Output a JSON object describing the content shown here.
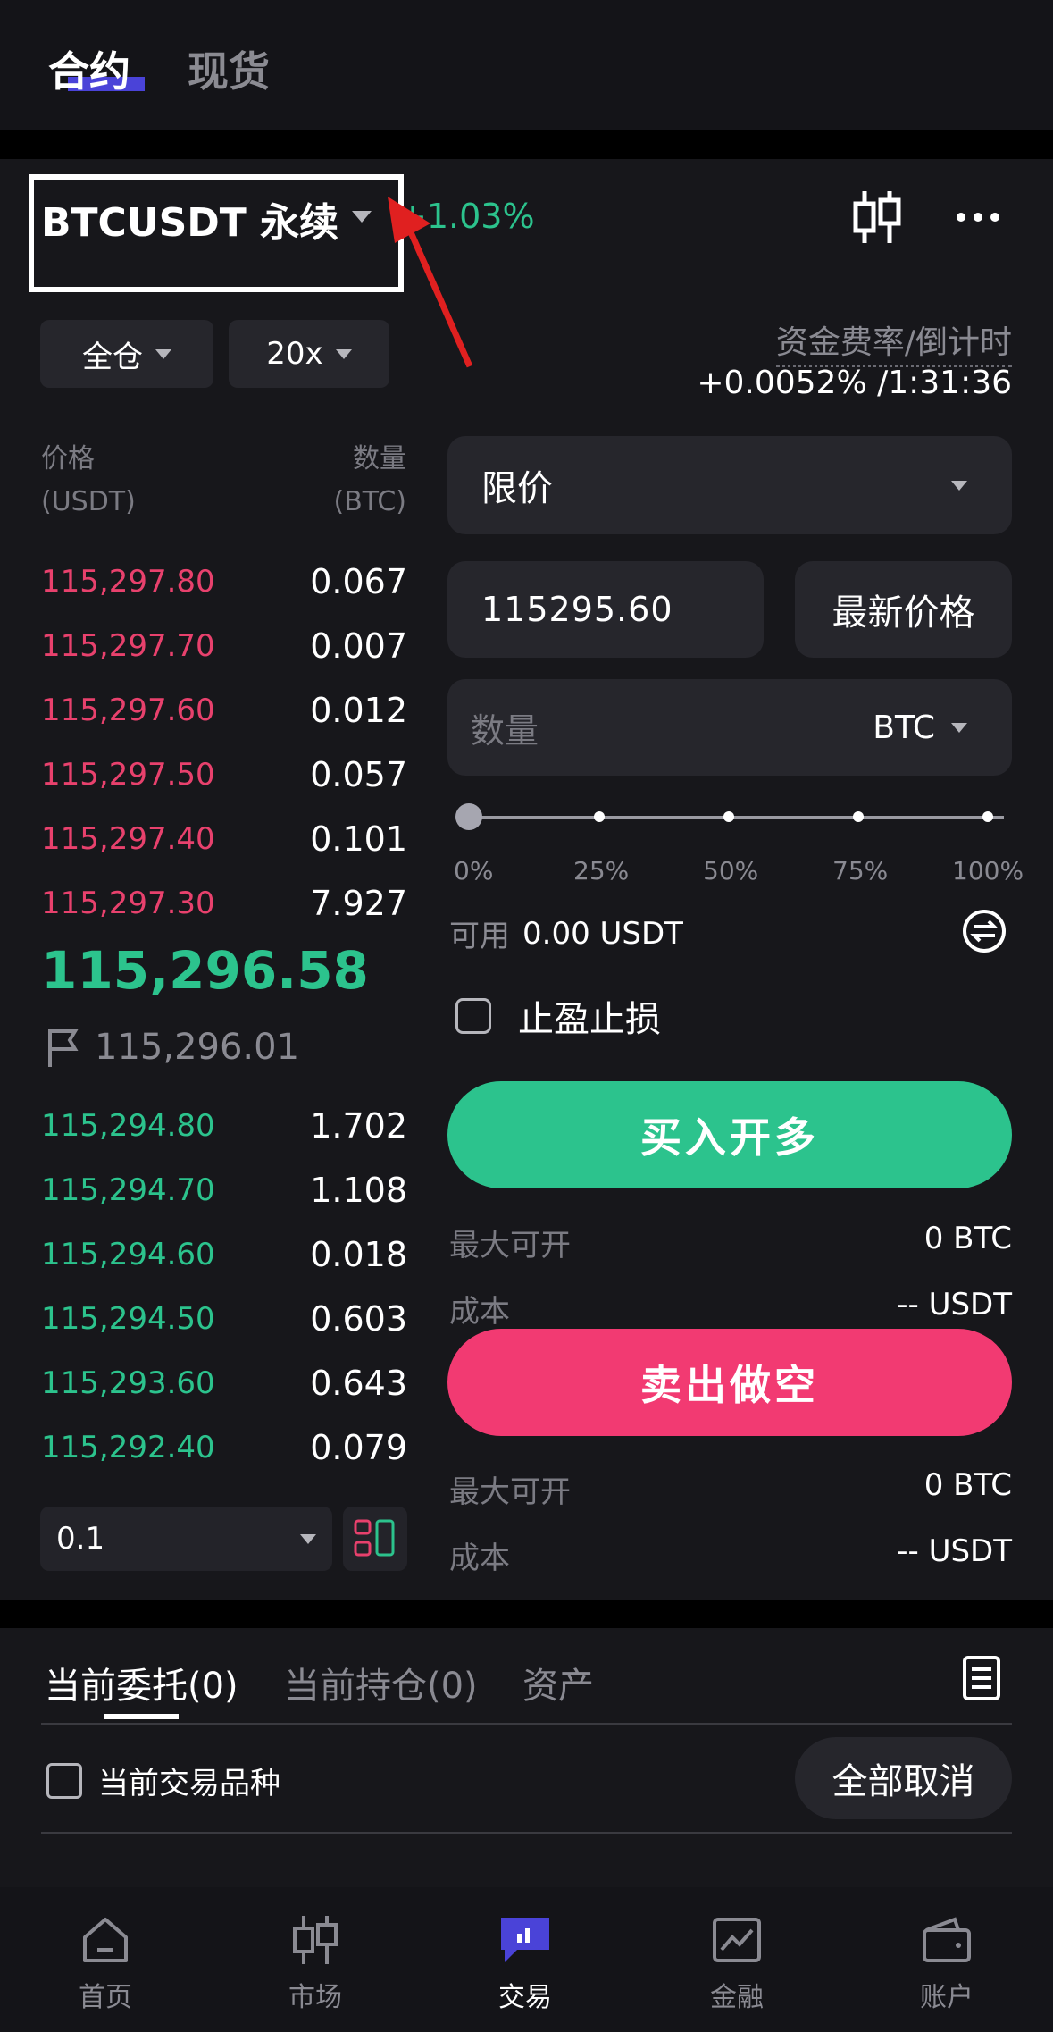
{
  "header": {
    "tabs": [
      {
        "label": "合约"
      },
      {
        "label": "现货"
      }
    ]
  },
  "symbol": {
    "name": "BTCUSDT 永续",
    "change": "+1.03%"
  },
  "margin": {
    "mode": "全仓",
    "leverage": "20x"
  },
  "funding": {
    "label": "资金费率/倒计时",
    "value": "+0.0052% /1:31:36"
  },
  "orderbook": {
    "price_header": "价格",
    "price_unit": "(USDT)",
    "qty_header": "数量",
    "qty_unit": "(BTC)",
    "asks": [
      {
        "price": "115,297.80",
        "qty": "0.067"
      },
      {
        "price": "115,297.70",
        "qty": "0.007"
      },
      {
        "price": "115,297.60",
        "qty": "0.012"
      },
      {
        "price": "115,297.50",
        "qty": "0.057"
      },
      {
        "price": "115,297.40",
        "qty": "0.101"
      },
      {
        "price": "115,297.30",
        "qty": "7.927"
      }
    ],
    "last_price": "115,296.58",
    "mark_price": "115,296.01",
    "bids": [
      {
        "price": "115,294.80",
        "qty": "1.702"
      },
      {
        "price": "115,294.70",
        "qty": "1.108"
      },
      {
        "price": "115,294.60",
        "qty": "0.018"
      },
      {
        "price": "115,294.50",
        "qty": "0.603"
      },
      {
        "price": "115,293.60",
        "qty": "0.643"
      },
      {
        "price": "115,292.40",
        "qty": "0.079"
      }
    ],
    "step": "0.1"
  },
  "order_form": {
    "type": "限价",
    "price_value": "115295.60",
    "latest_price_label": "最新价格",
    "qty_placeholder": "数量",
    "qty_unit": "BTC",
    "slider_marks": [
      "0%",
      "25%",
      "50%",
      "75%",
      "100%"
    ],
    "slider_level": 0,
    "available_label": "可用",
    "available_value": "0.00 USDT",
    "tpsl_label": "止盈止损",
    "buy_label": "买入开多",
    "sell_label": "卖出做空",
    "buy_info": {
      "max_label": "最大可开",
      "max_value": "0 BTC",
      "cost_label": "成本",
      "cost_value": "-- USDT"
    },
    "sell_info": {
      "max_label": "最大可开",
      "max_value": "0 BTC",
      "cost_label": "成本",
      "cost_value": "-- USDT"
    }
  },
  "orders": {
    "tabs": [
      {
        "label": "当前委托(0)"
      },
      {
        "label": "当前持仓(0)"
      },
      {
        "label": "资产"
      }
    ],
    "filter_label": "当前交易品种",
    "cancel_all": "全部取消"
  },
  "bottom_nav": [
    {
      "label": "首页",
      "icon": "home-icon"
    },
    {
      "label": "市场",
      "icon": "candlestick-icon"
    },
    {
      "label": "交易",
      "icon": "trade-icon"
    },
    {
      "label": "金融",
      "icon": "chart-icon"
    },
    {
      "label": "账户",
      "icon": "wallet-icon"
    }
  ],
  "colors": {
    "buy": "#2cc38d",
    "sell": "#f23a72",
    "accent": "#4a43d8"
  }
}
